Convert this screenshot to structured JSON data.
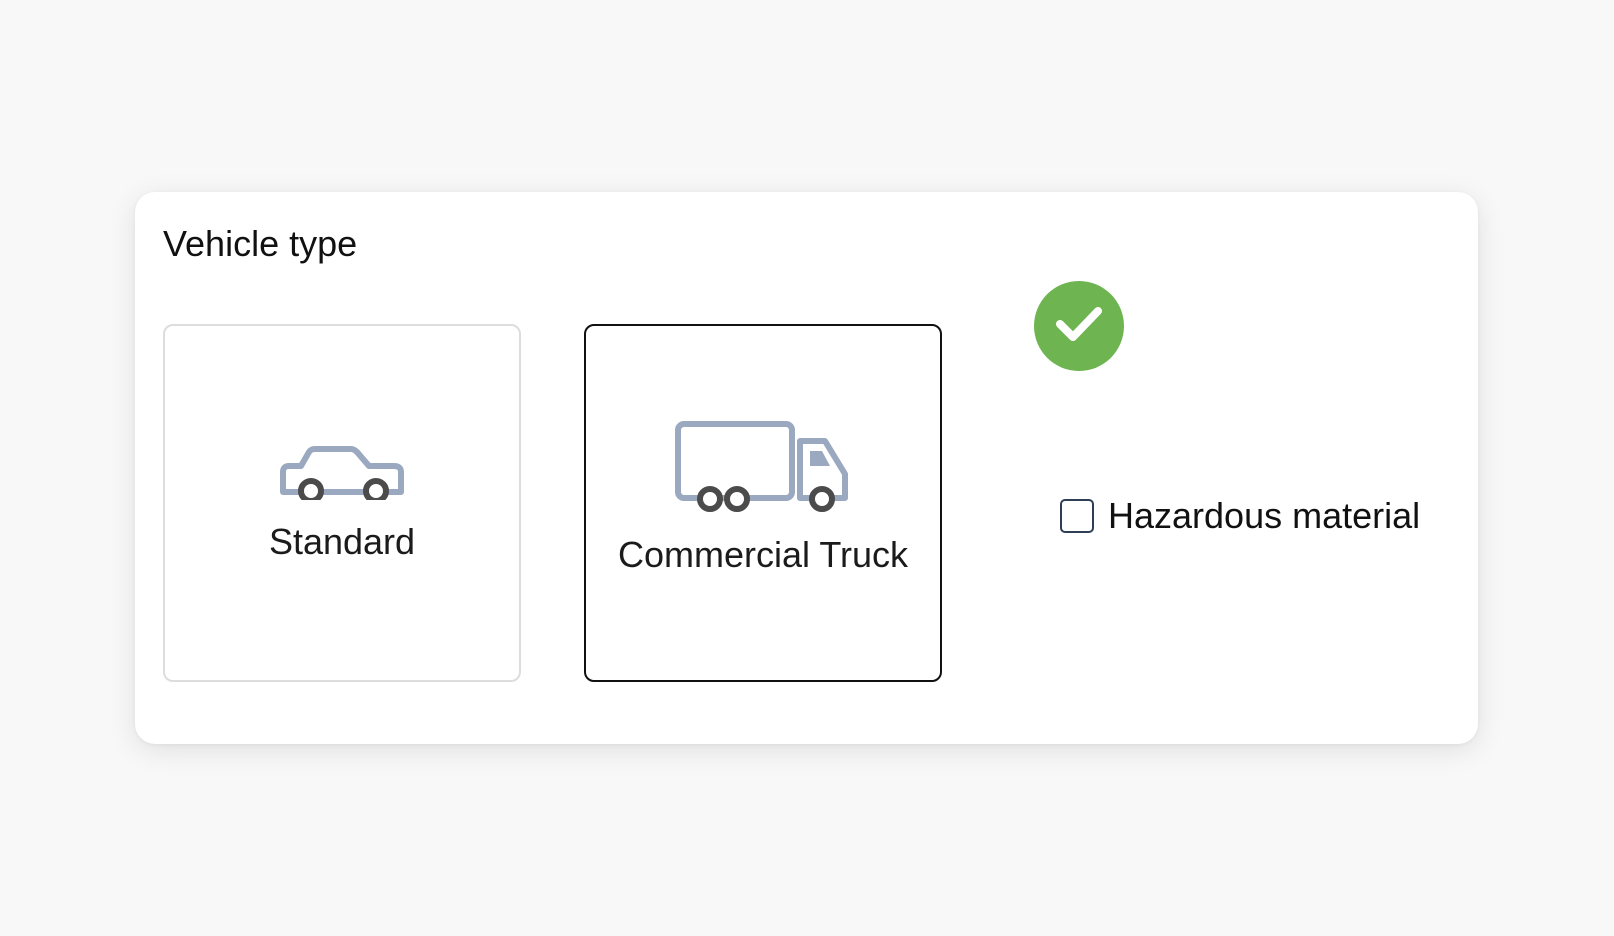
{
  "section": {
    "title": "Vehicle type"
  },
  "vehicle_options": [
    {
      "label": "Standard",
      "icon": "car-icon",
      "selected": false
    },
    {
      "label": "Commercial Truck",
      "icon": "truck-icon",
      "selected": true
    }
  ],
  "selected_badge": {
    "icon": "checkmark-icon",
    "color": "#6eb451"
  },
  "hazardous": {
    "label": "Hazardous material",
    "checked": false
  },
  "colors": {
    "icon_outline": "#9aa9bf",
    "wheel": "#4b4b4b",
    "selected_border": "#111111",
    "unselected_border": "#dddddd"
  }
}
